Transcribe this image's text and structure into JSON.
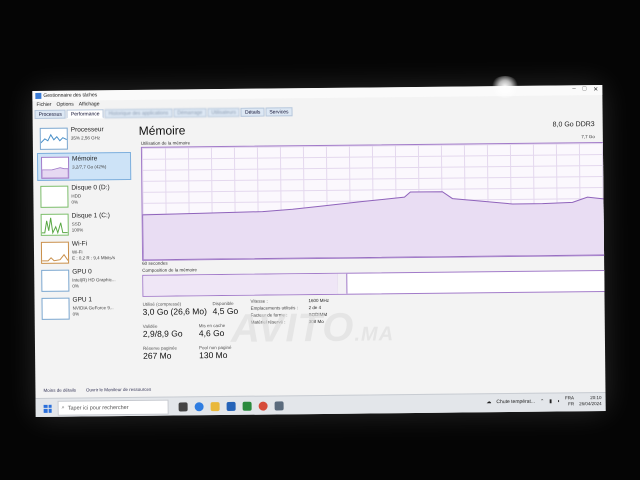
{
  "window": {
    "title": "Gestionnaire des tâches",
    "menu": [
      "Fichier",
      "Options",
      "Affichage"
    ],
    "tabs": [
      "Processus",
      "Performance",
      "Historique des applications",
      "Démarrage",
      "Utilisateurs",
      "Détails",
      "Services"
    ]
  },
  "sidebar": {
    "items": [
      {
        "name": "Processeur",
        "line1": "35% 2,56 GHz",
        "line2": "",
        "color": "#4a90c8"
      },
      {
        "name": "Mémoire",
        "line1": "3,2/7,7 Go (42%)",
        "line2": "",
        "color": "#a27bc9"
      },
      {
        "name": "Disque 0 (D:)",
        "line1": "HDD",
        "line2": "0%",
        "color": "#7bbd6a"
      },
      {
        "name": "Disque 1 (C:)",
        "line1": "SSD",
        "line2": "100%",
        "color": "#7bbd6a"
      },
      {
        "name": "Wi-Fi",
        "line1": "Wi-Fi",
        "line2": "E : 0,2  R : 9,4 Mbits/s",
        "color": "#b07a3a"
      },
      {
        "name": "GPU 0",
        "line1": "Intel(R) HD Graphic...",
        "line2": "0%",
        "color": "#4a90c8"
      },
      {
        "name": "GPU 1",
        "line1": "NVIDIA GeForce 9...",
        "line2": "0%",
        "color": "#4a90c8"
      }
    ],
    "footer": [
      "Moins de détails",
      "Ouvrir le Moniteur de ressources"
    ]
  },
  "main": {
    "title": "Mémoire",
    "total": "8,0 Go DDR3",
    "usage_label": "Utilisation de la mémoire",
    "usage_max": "7,7 Go",
    "seconds_label": "60 secondes",
    "composition_label": "Composition de la mémoire",
    "usage_fill": 0.42,
    "stats": {
      "used_label": "Utilisé (compressé)",
      "used_value": "3,0 Go (26,6 Mo)",
      "available_label": "Disponible",
      "available_value": "4,5 Go",
      "committed_label": "Validée",
      "committed_value": "2,9/8,9 Go",
      "cached_label": "Mis en cache",
      "cached_value": "4,6 Go",
      "paged_label": "Réserve paginée",
      "paged_value": "267 Mo",
      "nonpaged_label": "Pool non paginé",
      "nonpaged_value": "130 Mo"
    },
    "details": {
      "speed_label": "Vitesse :",
      "speed_value": "1600 MHz",
      "slots_label": "Emplacements utilisés :",
      "slots_value": "2 de 4",
      "form_label": "Facteur de forme :",
      "form_value": "SODIMM",
      "reserved_label": "Matériel réservé :",
      "reserved_value": "308 Mo"
    }
  },
  "watermark": {
    "main": "AVITO",
    "suffix": ".MA"
  },
  "taskbar": {
    "search_placeholder": "Taper ici pour rechercher",
    "weather": "Chute températ...",
    "lang_line1": "FRA",
    "lang_line2": "FR",
    "time": "20:10",
    "date": "26/04/2024"
  },
  "colors": {
    "memory_accent": "#a27bc9",
    "selected_bg": "#cde3f7"
  }
}
